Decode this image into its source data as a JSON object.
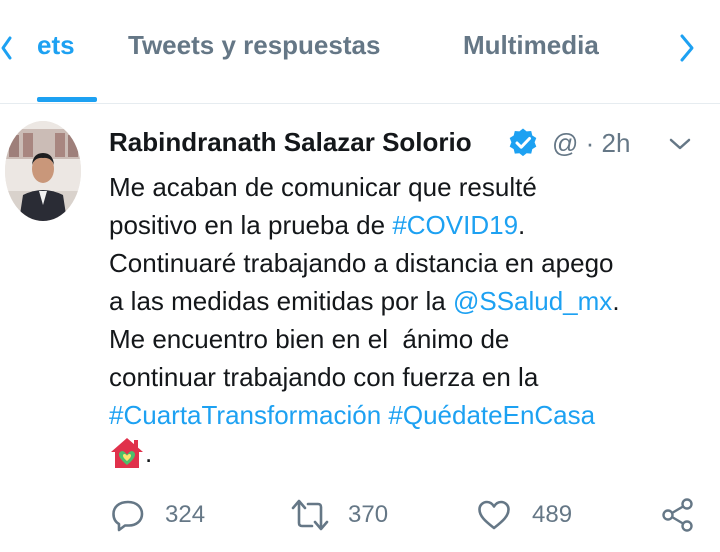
{
  "tabs": {
    "active_partial_label": "ets",
    "items": [
      {
        "label": "Tweets y respuestas"
      },
      {
        "label": "Multimedia"
      }
    ]
  },
  "tweet": {
    "author_name": "Rabindranath Salazar Solorio",
    "handle_partial": "@",
    "separator": "·",
    "time": "2h",
    "text_segments": [
      {
        "text": "Me acaban de comunicar que resulté",
        "type": "text"
      },
      {
        "text": "positivo en la prueba de ",
        "type": "text"
      },
      {
        "text": "#COVID19",
        "type": "hashtag"
      },
      {
        "text": ".",
        "type": "text"
      },
      {
        "text": "Continuaré trabajando a distancia en apego",
        "type": "text"
      },
      {
        "text": "a las medidas emitidas por la ",
        "type": "text"
      },
      {
        "text": "@SSalud_mx",
        "type": "mention"
      },
      {
        "text": ".",
        "type": "text"
      },
      {
        "text": "Me encuentro bien en el  ánimo de",
        "type": "text"
      },
      {
        "text": "continuar trabajando con fuerza en la",
        "type": "text"
      },
      {
        "text": "#CuartaTransformación",
        "type": "hashtag"
      },
      {
        "text": " ",
        "type": "text"
      },
      {
        "text": "#QuédateEnCasa",
        "type": "hashtag"
      },
      {
        "text": ".",
        "type": "text"
      }
    ],
    "house_emoji_icon": "house-with-heart-icon",
    "actions": {
      "reply_count": "324",
      "retweet_count": "370",
      "like_count": "489"
    }
  },
  "colors": {
    "accent": "#1da1f2",
    "secondary_text": "#657786",
    "primary_text": "#14171a"
  }
}
